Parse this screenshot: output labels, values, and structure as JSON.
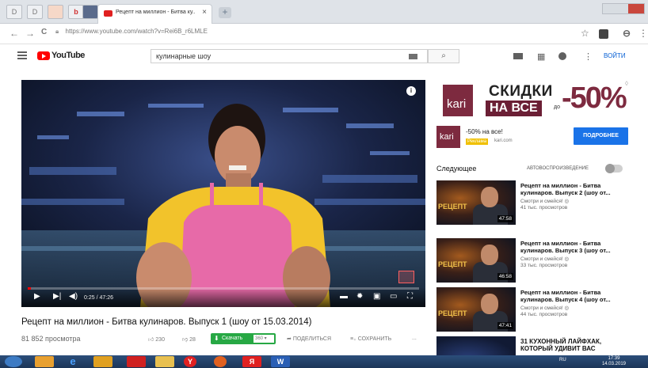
{
  "browser": {
    "tab_title": "Рецепт на миллион - Битва ку...",
    "tab_close": "×",
    "new_tab": "+",
    "pinned_tabs": [
      "D",
      "D",
      "",
      "b",
      ""
    ],
    "url": "https://www.youtube.com/watch?v=Rei6B_r6LMLE",
    "nav": {
      "back": "←",
      "forward": "→",
      "reload": "C"
    },
    "toolbar_icons": {
      "star": "☆",
      "account": "⊖",
      "menu": "⋮"
    }
  },
  "youtube": {
    "logo_text": "YouTube",
    "search_query": "кулинарные шоу",
    "search_icon": "search-icon",
    "signin_label": "ВОЙТИ"
  },
  "player": {
    "timecode": "0:25 / 47:26",
    "progress": 0.009,
    "accent": "#ff0000"
  },
  "video": {
    "title": "Рецепт на миллион - Битва кулинаров. Выпуск 1 (шоу от 15.03.2014)",
    "views": "81 852 просмотра",
    "likes": "230",
    "dislikes": "28",
    "download_label": "Скачать",
    "download_quality": "360 ▾",
    "share_label": "ПОДЕЛИТЬСЯ",
    "save_label": "СОХРАНИТЬ",
    "more_label": "..."
  },
  "ad": {
    "brand": "kari",
    "line1": "СКИДКИ",
    "line2": "НА ВСЕ",
    "do": "до",
    "percent": "-50%",
    "close": "◊",
    "promo_text": "-50% на все!",
    "promo_badge": "Реклама",
    "promo_domain": "kari.com",
    "more_button": "ПОДРОБНЕЕ",
    "brand_color": "#7d2a3f",
    "button_color": "#1a73e8"
  },
  "sidebar": {
    "next_label": "Следующее",
    "autoplay_label": "АВТОВОСПРОИЗВЕДЕНИЕ",
    "items": [
      {
        "title": "Рецепт на миллион - Битва кулинаров. Выпуск 2 (шоу от...",
        "channel": "Смотри и смейся! ◎",
        "views": "41 тыс. просмотров",
        "duration": "47:58",
        "logo": "РЕЦЕПТ"
      },
      {
        "title": "Рецепт на миллион - Битва кулинаров. Выпуск 3 (шоу от...",
        "channel": "Смотри и смейся! ◎",
        "views": "33 тыс. просмотров",
        "duration": "46:58",
        "logo": "РЕЦЕПТ"
      },
      {
        "title": "Рецепт на миллион - Битва кулинаров. Выпуск 4 (шоу от...",
        "channel": "Смотри и смейся! ◎",
        "views": "44 тыс. просмотров",
        "duration": "47:41",
        "logo": "РЕЦЕПТ"
      },
      {
        "title": "31 КУХОННЫЙ ЛАЙФХАК, КОТОРЫЙ УДИВИТ ВАС",
        "channel": "",
        "views": "",
        "duration": "",
        "logo": ""
      }
    ]
  },
  "taskbar": {
    "lang": "RU",
    "time": "17:39",
    "date": "14.03.2019"
  }
}
